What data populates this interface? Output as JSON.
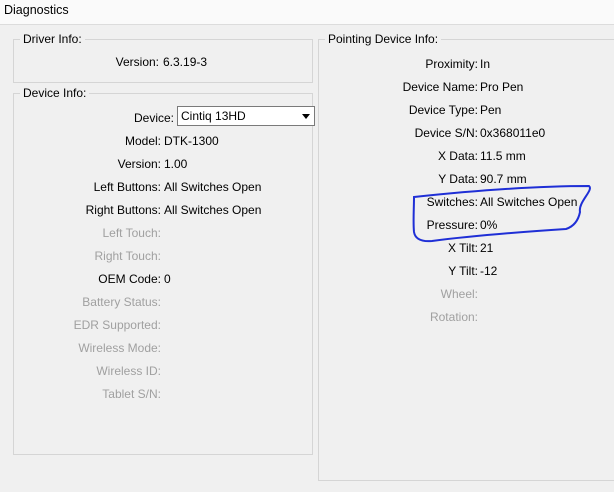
{
  "window": {
    "title": "Diagnostics"
  },
  "driver_info": {
    "legend": "Driver Info:",
    "version_label": "Version:",
    "version_value": "6.3.19-3"
  },
  "device_info": {
    "legend": "Device Info:",
    "device_label": "Device:",
    "device_selected": "Cintiq 13HD",
    "rows": [
      {
        "label": "Model:",
        "value": "DTK-1300",
        "enabled": true
      },
      {
        "label": "Version:",
        "value": "1.00",
        "enabled": true
      },
      {
        "label": "Left Buttons:",
        "value": "All Switches Open",
        "enabled": true
      },
      {
        "label": "Right Buttons:",
        "value": "All Switches Open",
        "enabled": true
      },
      {
        "label": "Left Touch:",
        "value": "",
        "enabled": false
      },
      {
        "label": "Right Touch:",
        "value": "",
        "enabled": false
      },
      {
        "label": "OEM Code:",
        "value": "0",
        "enabled": true
      },
      {
        "label": "Battery Status:",
        "value": "",
        "enabled": false
      },
      {
        "label": "EDR Supported:",
        "value": "",
        "enabled": false
      },
      {
        "label": "Wireless Mode:",
        "value": "",
        "enabled": false
      },
      {
        "label": "Wireless ID:",
        "value": "",
        "enabled": false
      },
      {
        "label": "Tablet S/N:",
        "value": "",
        "enabled": false
      }
    ]
  },
  "pointing_info": {
    "legend": "Pointing Device Info:",
    "rows": [
      {
        "label": "Proximity:",
        "value": "In",
        "enabled": true
      },
      {
        "label": "Device Name:",
        "value": "Pro Pen",
        "enabled": true
      },
      {
        "label": "Device Type:",
        "value": "Pen",
        "enabled": true
      },
      {
        "label": "Device S/N:",
        "value": "0x368011e0",
        "enabled": true
      },
      {
        "label": "X Data:",
        "value": "11.5 mm",
        "enabled": true
      },
      {
        "label": "Y Data:",
        "value": "90.7 mm",
        "enabled": true
      },
      {
        "label": "Switches:",
        "value": "All Switches Open",
        "enabled": true
      },
      {
        "label": "Pressure:",
        "value": "0%",
        "enabled": true
      },
      {
        "label": "X Tilt:",
        "value": "21",
        "enabled": true
      },
      {
        "label": "Y Tilt:",
        "value": "-12",
        "enabled": true
      },
      {
        "label": "Wheel:",
        "value": "",
        "enabled": false
      },
      {
        "label": "Rotation:",
        "value": "",
        "enabled": false
      }
    ]
  },
  "colors": {
    "annotation_ink": "#1f2fd6",
    "disabled_text": "#a0a0a0",
    "panel_border": "#d5d5d5"
  }
}
